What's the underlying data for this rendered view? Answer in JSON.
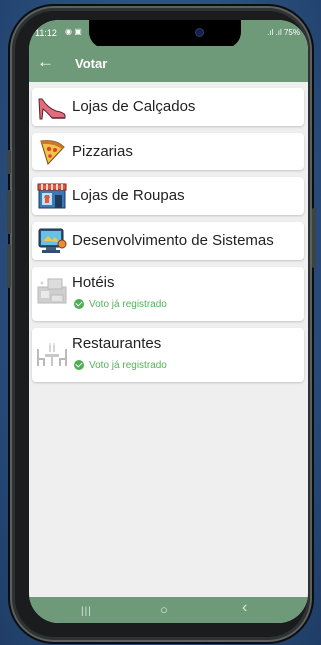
{
  "status_bar": {
    "time": "11:12",
    "notification_icons": "◉ ▣",
    "signal": ".ıl .ıl 75%"
  },
  "app_bar": {
    "back_icon": "←",
    "title": "Votar"
  },
  "categories": [
    {
      "label": "Lojas de Calçados",
      "icon": "high-heel-icon",
      "voted": false
    },
    {
      "label": "Pizzarias",
      "icon": "pizza-icon",
      "voted": false
    },
    {
      "label": "Lojas de Roupas",
      "icon": "clothing-store-icon",
      "voted": false
    },
    {
      "label": "Desenvolvimento de Sistemas",
      "icon": "computer-icon",
      "voted": false
    },
    {
      "label": "Hotéis",
      "icon": "hotel-icon",
      "voted": true,
      "status": "Voto já registrado"
    },
    {
      "label": "Restaurantes",
      "icon": "restaurant-icon",
      "voted": true,
      "status": "Voto já registrado"
    }
  ],
  "nav_bar": {
    "recents": "|||",
    "home": "○",
    "back": "‹"
  },
  "colors": {
    "accent": "#6f9a7a",
    "voted": "#4caf50"
  }
}
